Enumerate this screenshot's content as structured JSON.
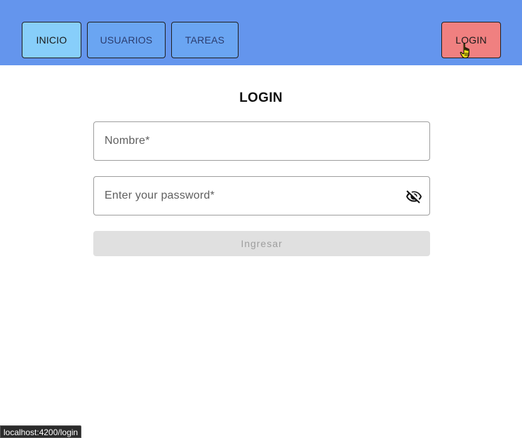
{
  "nav": {
    "inicio": "INICIO",
    "usuarios": "USUARIOS",
    "tareas": "TAREAS",
    "login": "LOGIN"
  },
  "form": {
    "title": "LOGIN",
    "nombre_placeholder": "Nombre*",
    "password_placeholder": "Enter your password*",
    "submit_label": "Ingresar",
    "submit_disabled": true,
    "password_visibility_icon": "eye-off-icon"
  },
  "status_bar": {
    "url": "localhost:4200/login"
  },
  "colors": {
    "topbar": "#6495ed",
    "inicio_bg": "#87cefa",
    "tab_bg": "#6aa5f2",
    "login_bg": "#f08080",
    "submit_disabled_bg": "#e0e0e0"
  }
}
